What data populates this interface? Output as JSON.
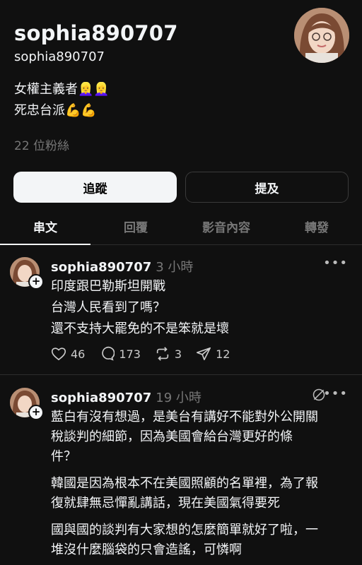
{
  "profile": {
    "display_name": "sophia890707",
    "handle": "sophia890707",
    "bio_line1": "女權主義者👱‍♀️👱‍♀️",
    "bio_line2": "死忠台派💪💪",
    "followers": "22 位粉絲"
  },
  "buttons": {
    "follow": "追蹤",
    "mention": "提及"
  },
  "tabs": [
    "串文",
    "回覆",
    "影音內容",
    "轉發"
  ],
  "posts": [
    {
      "user": "sophia890707",
      "time": "3 小時",
      "lines": [
        "印度跟巴勒斯坦開戰",
        "台灣人民看到了嗎？",
        "還不支持大罷免的不是笨就是壞"
      ],
      "likes": "46",
      "comments": "173",
      "reposts": "3",
      "shares": "12"
    },
    {
      "user": "sophia890707",
      "time": "19 小時",
      "lines": [
        "藍白有沒有想過，是美台有講好不能對外公開關",
        "稅談判的細節，因為美國會給台灣更好的條",
        "件？",
        "韓國是因為根本不在美國照顧的名單裡，為了報",
        "復就肆無忌憚亂講話，現在美國氣得要死",
        "國與國的談判有大家想的怎麼簡單就好了啦，一",
        "堆沒什麼腦袋的只會造謠，可憐啊"
      ]
    }
  ],
  "icons": {
    "more": "more-icon",
    "heart": "heart-icon",
    "comment": "comment-icon",
    "repost": "repost-icon",
    "share": "share-icon",
    "plus": "plus-icon",
    "quote": "quote-off-icon"
  }
}
